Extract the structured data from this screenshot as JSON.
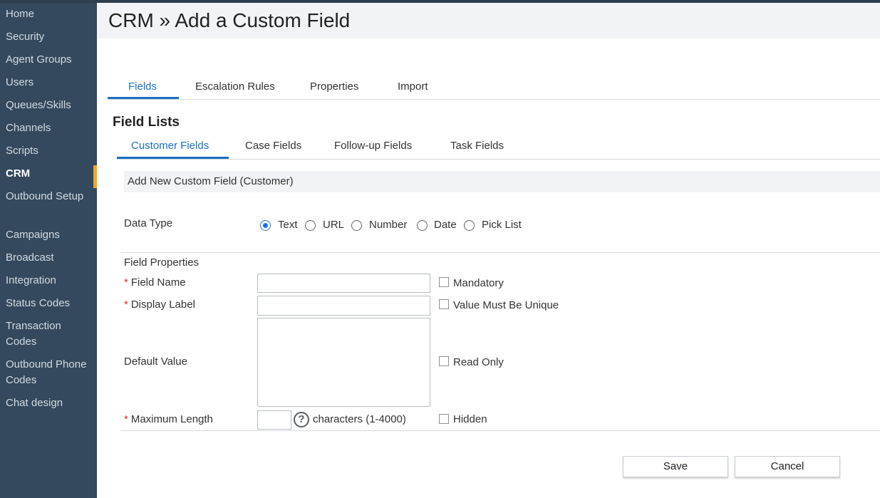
{
  "sidebar": {
    "items": [
      {
        "label": "Home"
      },
      {
        "label": "Security"
      },
      {
        "label": "Agent Groups"
      },
      {
        "label": "Users"
      },
      {
        "label": "Queues/Skills"
      },
      {
        "label": "Channels"
      },
      {
        "label": "Scripts"
      },
      {
        "label": "CRM"
      },
      {
        "label": "Outbound Setup"
      },
      {
        "label": "Campaigns"
      },
      {
        "label": "Broadcast"
      },
      {
        "label": "Integration"
      },
      {
        "label": "Status Codes"
      },
      {
        "label": "Transaction Codes"
      },
      {
        "label": "Outbound Phone Codes"
      },
      {
        "label": "Chat design"
      }
    ],
    "active": "CRM"
  },
  "header": {
    "title": "CRM » Add a Custom Field"
  },
  "tabs": [
    {
      "label": "Fields"
    },
    {
      "label": "Escalation Rules"
    },
    {
      "label": "Properties"
    },
    {
      "label": "Import"
    }
  ],
  "field_lists": {
    "title": "Field Lists",
    "tabs": [
      {
        "label": "Customer Fields"
      },
      {
        "label": "Case Fields"
      },
      {
        "label": "Follow-up Fields"
      },
      {
        "label": "Task Fields"
      }
    ]
  },
  "form": {
    "heading": "Add New Custom Field (Customer)",
    "data_type": {
      "label": "Data Type",
      "options": [
        {
          "label": "Text"
        },
        {
          "label": "URL"
        },
        {
          "label": "Number"
        },
        {
          "label": "Date"
        },
        {
          "label": "Pick List"
        }
      ],
      "selected": "Text"
    },
    "properties_title": "Field Properties",
    "required_mark": "*",
    "field_name": {
      "label": "Field Name",
      "value": ""
    },
    "display_label": {
      "label": "Display Label",
      "value": ""
    },
    "default_value": {
      "label": "Default Value",
      "value": ""
    },
    "max_length": {
      "label": "Maximum Length",
      "value": "",
      "suffix": "characters (1-4000)",
      "help": "?"
    },
    "checkboxes": {
      "mandatory": {
        "label": "Mandatory",
        "checked": false
      },
      "unique": {
        "label": "Value Must Be Unique",
        "checked": false
      },
      "read_only": {
        "label": "Read Only",
        "checked": false
      },
      "hidden": {
        "label": "Hidden",
        "checked": false
      }
    }
  },
  "buttons": {
    "save": "Save",
    "cancel": "Cancel"
  }
}
